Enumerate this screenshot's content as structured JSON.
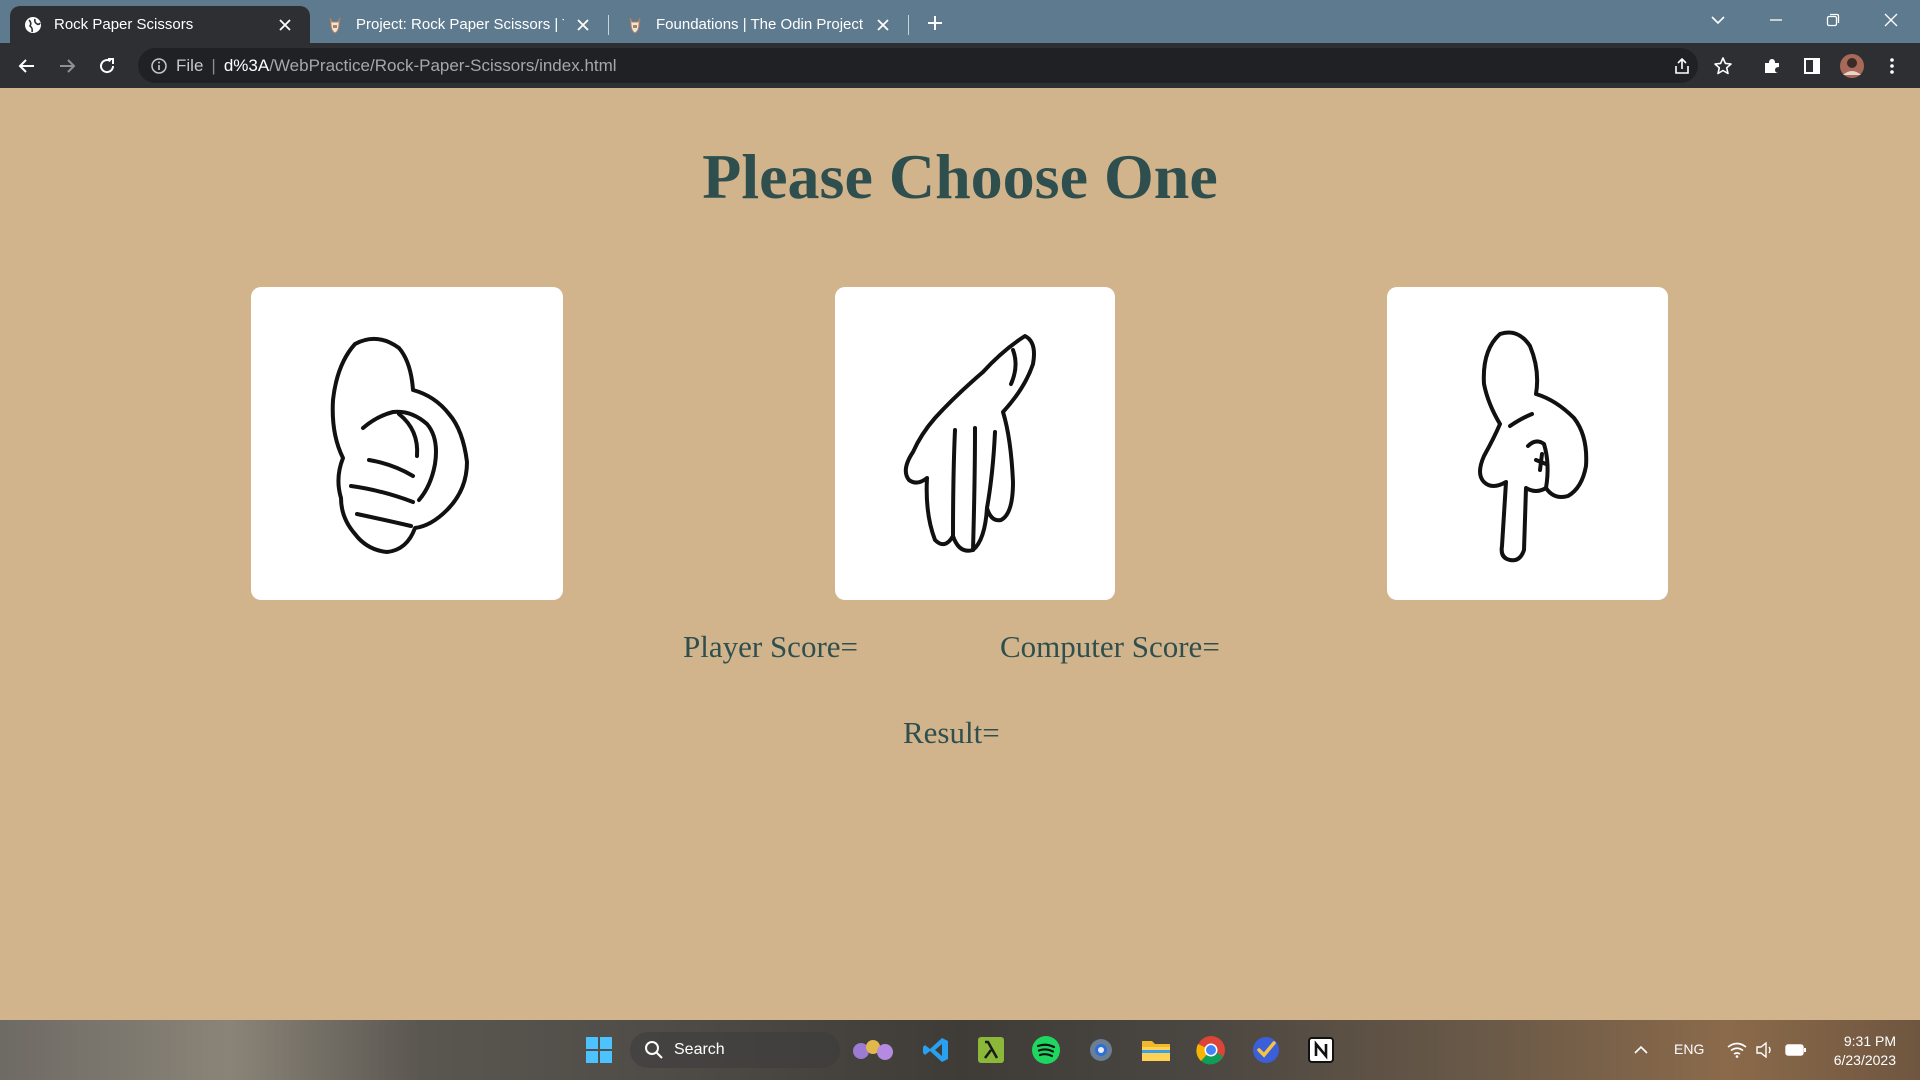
{
  "browser": {
    "tabs": [
      {
        "title": "Rock Paper Scissors",
        "favicon": "globe-icon",
        "active": true
      },
      {
        "title": "Project: Rock Paper Scissors | The Odin Project",
        "favicon": "odin-project-icon",
        "active": false
      },
      {
        "title": "Foundations | The Odin Project",
        "favicon": "odin-project-icon",
        "active": false
      }
    ],
    "address": {
      "scheme_label": "File",
      "host": "d%3A",
      "path": "/WebPractice/Rock-Paper-Scissors/index.html"
    }
  },
  "page": {
    "heading": "Please Choose One",
    "choices": [
      {
        "name": "rock",
        "icon": "fist-hand-icon"
      },
      {
        "name": "paper",
        "icon": "open-hand-icon"
      },
      {
        "name": "scissors",
        "icon": "two-finger-hand-icon"
      }
    ],
    "player_score_label": "Player Score=",
    "computer_score_label": "Computer Score=",
    "result_label": "Result="
  },
  "taskbar": {
    "search_placeholder": "Search",
    "apps": [
      "windows-start-icon",
      "widgets-icon",
      "vscode-icon",
      "lambda-app-icon",
      "spotify-icon",
      "settings-icon",
      "file-explorer-icon",
      "chrome-icon",
      "tasks-check-icon",
      "notion-icon"
    ],
    "language": "ENG",
    "time": "9:31 PM",
    "date": "6/23/2023"
  },
  "colors": {
    "page_background": "#d2b48c",
    "heading_text": "#2f4f4f",
    "tabstrip": "#5e7a8f",
    "toolbar": "#2d2f33"
  }
}
